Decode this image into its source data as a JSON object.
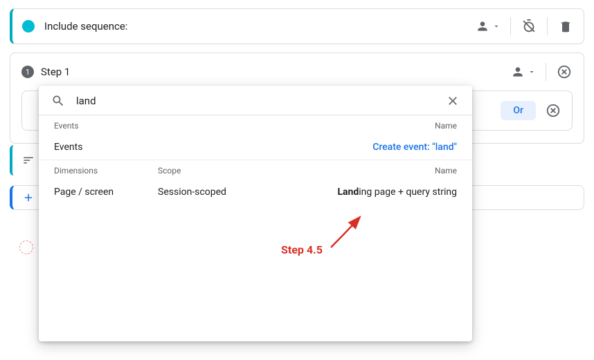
{
  "sequence": {
    "title": "Include sequence:"
  },
  "step": {
    "num": "1",
    "label": "Step 1",
    "or_label": "Or"
  },
  "popover": {
    "search_value": "land",
    "events_header": {
      "c1": "Events",
      "c2": "Name"
    },
    "events_row": {
      "label": "Events",
      "create_link": "Create event: \"land\""
    },
    "dims_header": {
      "a": "Dimensions",
      "b": "Scope",
      "c": "Name"
    },
    "dims_row": {
      "a": "Page / screen",
      "b": "Session-scoped",
      "match_bold": "Land",
      "match_rest": "ing page + query string"
    }
  },
  "annotation": {
    "label": "Step 4.5"
  }
}
